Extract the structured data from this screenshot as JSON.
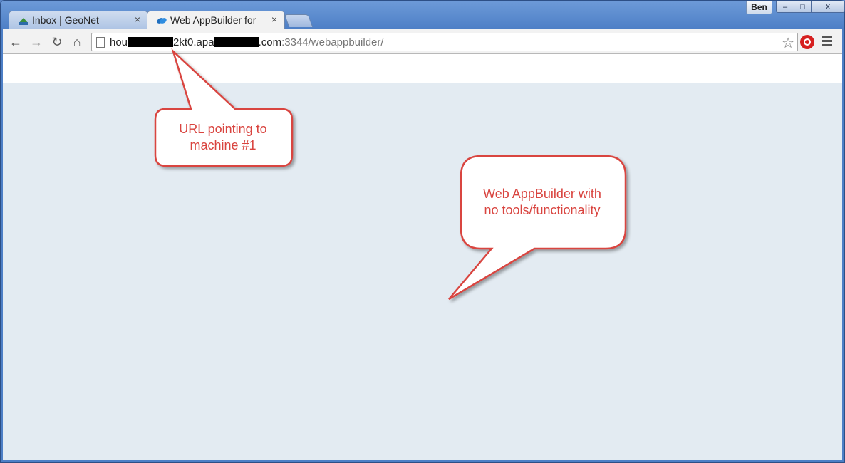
{
  "tabs": [
    {
      "title": "Inbox | GeoNet",
      "close": "×",
      "active": false,
      "favicon": "geonet-icon"
    },
    {
      "title": "Web AppBuilder for",
      "close": "×",
      "active": true,
      "favicon": "webappbuilder-icon"
    }
  ],
  "window": {
    "user": "Ben",
    "minimize": "–",
    "maximize": "□",
    "close": "X"
  },
  "toolbar": {
    "back": "←",
    "forward": "→",
    "reload": "↻",
    "home": "⌂",
    "url_seg1": "hou",
    "url_seg2": "2kt0.apa",
    "url_seg3": ".com",
    "url_path": ":3344/webappbuilder/",
    "bookmark_star": "☆"
  },
  "callouts": [
    {
      "text_line1": "URL pointing to",
      "text_line2": "machine #1"
    },
    {
      "text_line1": "Web AppBuilder with",
      "text_line2": "no tools/functionality"
    }
  ],
  "colors": {
    "callout_border": "#d9443f",
    "page_bg": "#e3ebf2",
    "frame": "#4d7fc6"
  }
}
